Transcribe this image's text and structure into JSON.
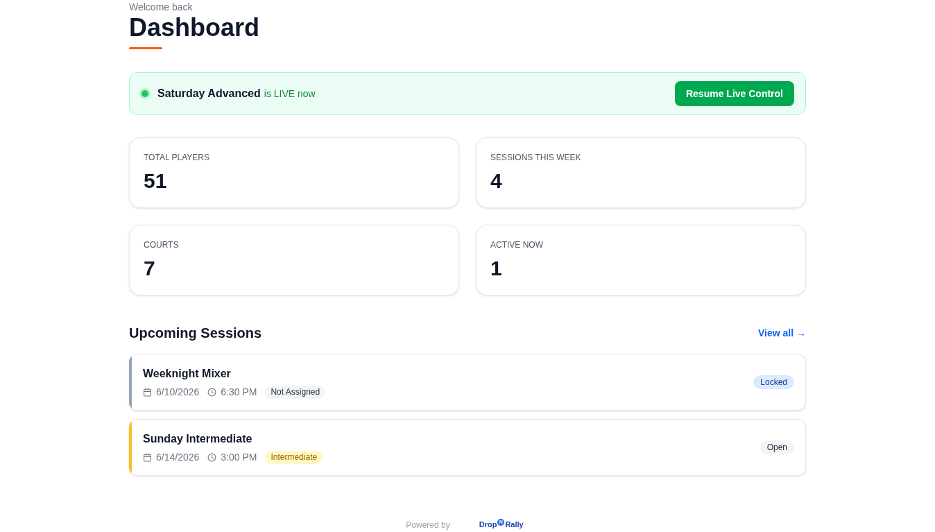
{
  "header": {
    "greeting": "Welcome back",
    "title": "Dashboard"
  },
  "live_banner": {
    "session": "Saturday Advanced",
    "status_text": "is LIVE now",
    "live": true,
    "button": "Resume Live Control"
  },
  "stats": [
    {
      "label": "TOTAL PLAYERS",
      "value": "51"
    },
    {
      "label": "SESSIONS THIS WEEK",
      "value": "4"
    },
    {
      "label": "COURTS",
      "value": "7"
    },
    {
      "label": "ACTIVE NOW",
      "value": "1"
    }
  ],
  "upcoming": {
    "title": "Upcoming Sessions",
    "view_all": "View all →",
    "sessions": [
      {
        "name": "Weeknight Mixer",
        "date": "6/10/2026",
        "time": "6:30 PM",
        "level": {
          "label": "Not Assigned",
          "kind": "unassigned"
        },
        "status": {
          "label": "Locked",
          "kind": "locked"
        },
        "color": "#94a3b8"
      },
      {
        "name": "Sunday Intermediate",
        "date": "6/14/2026",
        "time": "3:00 PM",
        "level": {
          "label": "Intermediate",
          "kind": "intermediate"
        },
        "status": {
          "label": "Open",
          "kind": "open"
        },
        "color": "#fbbf24"
      }
    ]
  },
  "footer": {
    "powered_by": "Powered by",
    "logo": {
      "left": "Drop",
      "badge": "N",
      "right": "Rally"
    }
  }
}
